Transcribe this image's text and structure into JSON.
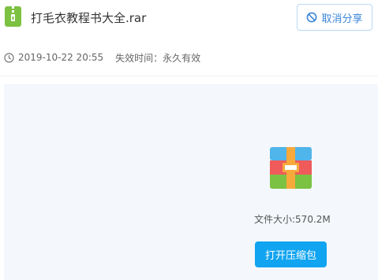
{
  "file": {
    "name": "打毛衣教程书大全.rar",
    "icon": "zip-file-icon"
  },
  "actions": {
    "cancel_share_label": "取消分享",
    "cancel_share_icon": "ban-icon",
    "open_archive_label": "打开压缩包"
  },
  "meta": {
    "clock_icon": "clock-icon",
    "date": "2019-10-22 20:55",
    "expire": "失效时间：永久有效"
  },
  "preview": {
    "archive_icon": "rar-archive-icon",
    "size": "文件大小:570.2M"
  },
  "colors": {
    "accent": "#11a4f0",
    "link_blue": "#3a86d8",
    "file_icon_green": "#7dc142",
    "panel_bg": "#f4f7fb"
  }
}
